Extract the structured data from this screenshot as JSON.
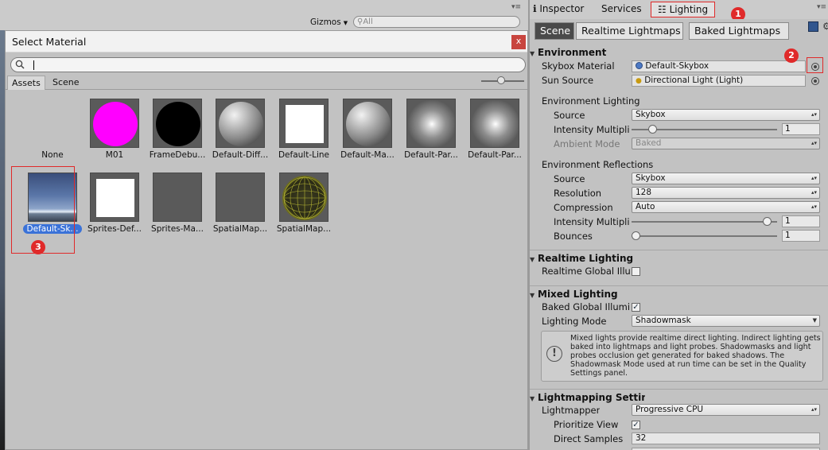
{
  "scene": {
    "gizmos_label": "Gizmos",
    "search_placeholder": "All"
  },
  "picker": {
    "title": "Select Material",
    "close_label": "x",
    "search_value": "",
    "tabs": [
      "Assets",
      "Scene"
    ],
    "zoom_level": 0.45,
    "items": [
      {
        "label": "None",
        "icon": "none"
      },
      {
        "label": "M01",
        "icon": "magenta-sphere"
      },
      {
        "label": "FrameDebu...",
        "icon": "black-sphere"
      },
      {
        "label": "Default-Diff...",
        "icon": "gray-sphere"
      },
      {
        "label": "Default-Line",
        "icon": "white-square"
      },
      {
        "label": "Default-Ma...",
        "icon": "gray-sphere"
      },
      {
        "label": "Default-Par...",
        "icon": "particle-glow"
      },
      {
        "label": "Default-Par...",
        "icon": "particle-glow"
      },
      {
        "label": "Default-Sk...",
        "icon": "skybox",
        "selected": true
      },
      {
        "label": "Sprites-Def...",
        "icon": "white-square"
      },
      {
        "label": "Sprites-Ma...",
        "icon": "blank"
      },
      {
        "label": "SpatialMap...",
        "icon": "blank"
      },
      {
        "label": "SpatialMap...",
        "icon": "wire-sphere"
      }
    ]
  },
  "callouts": [
    "1",
    "2",
    "3"
  ],
  "inspector": {
    "tabs": {
      "inspector": "Inspector",
      "services": "Services",
      "lighting": "Lighting"
    }
  },
  "lighting": {
    "modes": [
      "Scene",
      "Realtime Lightmaps",
      "Baked Lightmaps"
    ],
    "environment": {
      "header": "Environment",
      "skybox_label": "Skybox Material",
      "skybox_value": "Default-Skybox",
      "sun_label": "Sun Source",
      "sun_value": "Directional Light (Light)",
      "env_lighting_header": "Environment Lighting",
      "source_label": "Source",
      "source_value": "Skybox",
      "intensity_label": "Intensity Multiplier",
      "intensity_value": "1",
      "intensity_fraction": 0.12,
      "ambient_label": "Ambient Mode",
      "ambient_value": "Baked",
      "reflections_header": "Environment Reflections",
      "ref_source_label": "Source",
      "ref_source_value": "Skybox",
      "resolution_label": "Resolution",
      "resolution_value": "128",
      "compression_label": "Compression",
      "compression_value": "Auto",
      "ref_intensity_label": "Intensity Multiplier",
      "ref_intensity_value": "1",
      "ref_intensity_fraction": 0.96,
      "bounces_label": "Bounces",
      "bounces_value": "1",
      "bounces_fraction": 0.0
    },
    "realtime": {
      "header": "Realtime Lighting",
      "gi_label": "Realtime Global Illumination",
      "gi_checked": false
    },
    "mixed": {
      "header": "Mixed Lighting",
      "baked_gi_label": "Baked Global Illumination",
      "baked_gi_checked": true,
      "mode_label": "Lighting Mode",
      "mode_value": "Shadowmask",
      "help_text": "Mixed lights provide realtime direct lighting. Indirect lighting gets baked into lightmaps and light probes. Shadowmasks and light probes occlusion get generated for baked shadows. The Shadowmask Mode used at run time can be set in the Quality Settings panel."
    },
    "lightmapping": {
      "header": "Lightmapping Settings",
      "lightmapper_label": "Lightmapper",
      "lightmapper_value": "Progressive CPU",
      "prioritize_label": "Prioritize View",
      "prioritize_checked": true,
      "direct_samples_label": "Direct Samples",
      "direct_samples_value": "32"
    }
  },
  "colors": {
    "selection": "#3a72d8",
    "callout": "#e02a2a",
    "mode_active": "#4a4a4a"
  }
}
